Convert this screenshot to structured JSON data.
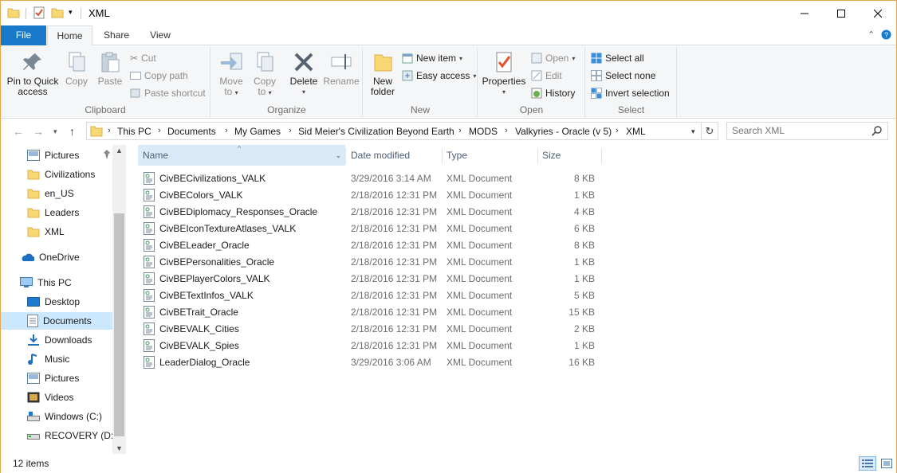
{
  "window": {
    "title": "XML",
    "controls": {
      "minimize": "minimize-icon",
      "maximize": "maximize-icon",
      "close": "close-icon"
    }
  },
  "tabs": {
    "file": "File",
    "home": "Home",
    "share": "Share",
    "view": "View"
  },
  "ribbon": {
    "clipboard": {
      "label": "Clipboard",
      "pin_line1": "Pin to Quick",
      "pin_line2": "access",
      "copy": "Copy",
      "paste": "Paste",
      "cut": "Cut",
      "copy_path": "Copy path",
      "paste_shortcut": "Paste shortcut"
    },
    "organize": {
      "label": "Organize",
      "move_to": "Move",
      "move_to2": "to",
      "copy_to": "Copy",
      "copy_to2": "to",
      "delete": "Delete",
      "rename": "Rename"
    },
    "new": {
      "label": "New",
      "new_folder1": "New",
      "new_folder2": "folder",
      "new_item": "New item",
      "easy_access": "Easy access"
    },
    "open": {
      "label": "Open",
      "properties": "Properties",
      "open": "Open",
      "edit": "Edit",
      "history": "History"
    },
    "select": {
      "label": "Select",
      "select_all": "Select all",
      "select_none": "Select none",
      "invert": "Invert selection"
    }
  },
  "address": {
    "crumbs": [
      "This PC",
      "Documents",
      "My Games",
      "Sid Meier's Civilization Beyond Earth",
      "MODS",
      "Valkyries - Oracle (v 5)",
      "XML"
    ]
  },
  "search": {
    "placeholder": "Search XML"
  },
  "nav": {
    "items": [
      {
        "label": "Pictures",
        "icon": "pictures-icon"
      },
      {
        "label": "Civilizations",
        "icon": "folder-icon"
      },
      {
        "label": "en_US",
        "icon": "folder-icon"
      },
      {
        "label": "Leaders",
        "icon": "folder-icon"
      },
      {
        "label": "XML",
        "icon": "folder-icon"
      },
      {
        "label": "OneDrive",
        "icon": "onedrive-icon"
      },
      {
        "label": "This PC",
        "icon": "this-pc-icon"
      },
      {
        "label": "Desktop",
        "icon": "desktop-icon"
      },
      {
        "label": "Documents",
        "icon": "documents-icon"
      },
      {
        "label": "Downloads",
        "icon": "downloads-icon"
      },
      {
        "label": "Music",
        "icon": "music-icon"
      },
      {
        "label": "Pictures",
        "icon": "pictures-icon"
      },
      {
        "label": "Videos",
        "icon": "videos-icon"
      },
      {
        "label": "Windows (C:)",
        "icon": "drive-c-icon"
      },
      {
        "label": "RECOVERY (D:)",
        "icon": "drive-d-icon"
      }
    ]
  },
  "columns": {
    "name": "Name",
    "modified": "Date modified",
    "type": "Type",
    "size": "Size"
  },
  "files": [
    {
      "name": "CivBECivilizations_VALK",
      "modified": "3/29/2016 3:14 AM",
      "type": "XML Document",
      "size": "8 KB"
    },
    {
      "name": "CivBEColors_VALK",
      "modified": "2/18/2016 12:31 PM",
      "type": "XML Document",
      "size": "1 KB"
    },
    {
      "name": "CivBEDiplomacy_Responses_Oracle",
      "modified": "2/18/2016 12:31 PM",
      "type": "XML Document",
      "size": "4 KB"
    },
    {
      "name": "CivBEIconTextureAtlases_VALK",
      "modified": "2/18/2016 12:31 PM",
      "type": "XML Document",
      "size": "6 KB"
    },
    {
      "name": "CivBELeader_Oracle",
      "modified": "2/18/2016 12:31 PM",
      "type": "XML Document",
      "size": "8 KB"
    },
    {
      "name": "CivBEPersonalities_Oracle",
      "modified": "2/18/2016 12:31 PM",
      "type": "XML Document",
      "size": "1 KB"
    },
    {
      "name": "CivBEPlayerColors_VALK",
      "modified": "2/18/2016 12:31 PM",
      "type": "XML Document",
      "size": "1 KB"
    },
    {
      "name": "CivBETextInfos_VALK",
      "modified": "2/18/2016 12:31 PM",
      "type": "XML Document",
      "size": "5 KB"
    },
    {
      "name": "CivBETrait_Oracle",
      "modified": "2/18/2016 12:31 PM",
      "type": "XML Document",
      "size": "15 KB"
    },
    {
      "name": "CivBEVALK_Cities",
      "modified": "2/18/2016 12:31 PM",
      "type": "XML Document",
      "size": "2 KB"
    },
    {
      "name": "CivBEVALK_Spies",
      "modified": "2/18/2016 12:31 PM",
      "type": "XML Document",
      "size": "1 KB"
    },
    {
      "name": "LeaderDialog_Oracle",
      "modified": "3/29/2016 3:06 AM",
      "type": "XML Document",
      "size": "16 KB"
    }
  ],
  "status": {
    "count": "12 items"
  },
  "colors": {
    "accent": "#1979ca",
    "selection": "#cce8ff",
    "border": "#e8a64c"
  }
}
